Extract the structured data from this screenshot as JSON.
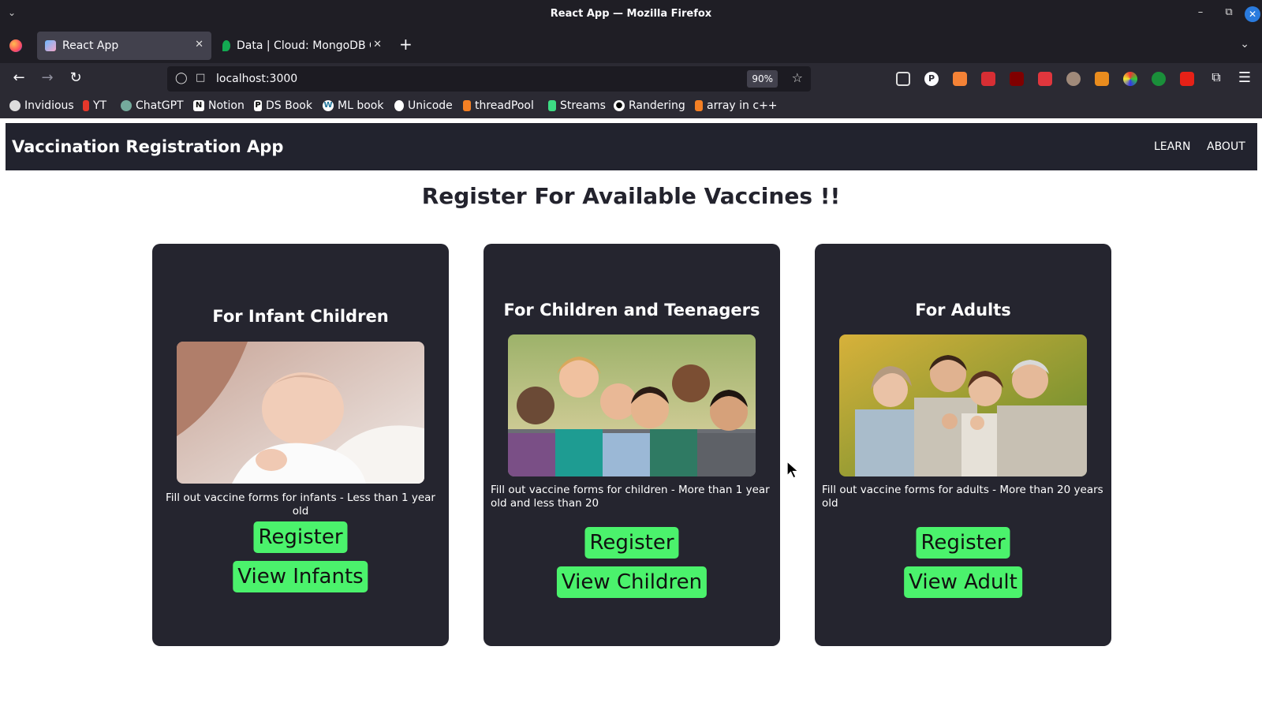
{
  "window": {
    "title": "React App — Mozilla Firefox"
  },
  "tabs": [
    {
      "label": "React App",
      "active": true
    },
    {
      "label": "Data | Cloud: MongoDB C",
      "active": false
    }
  ],
  "address_bar": {
    "url": "localhost:3000",
    "zoom": "90%"
  },
  "bookmarks": [
    {
      "label": "Invidious"
    },
    {
      "label": "YT"
    },
    {
      "label": "ChatGPT"
    },
    {
      "label": "Notion"
    },
    {
      "label": "DS Book"
    },
    {
      "label": "ML book"
    },
    {
      "label": "Unicode"
    },
    {
      "label": "threadPool"
    },
    {
      "label": "Streams"
    },
    {
      "label": "Randering"
    },
    {
      "label": "array in c++"
    }
  ],
  "app": {
    "brand": "Vaccination Registration App",
    "nav": [
      "LEARN",
      "ABOUT"
    ],
    "heading": "Register For Available Vaccines !!"
  },
  "cards": [
    {
      "title": "For Infant Children",
      "description": "Fill out vaccine forms for infants - Less than 1 year old",
      "register_label": "Register",
      "view_label": "View Infants"
    },
    {
      "title": "For Children and Teenagers",
      "description": "Fill out vaccine forms for children - More than 1 year old and less than 20",
      "register_label": "Register",
      "view_label": "View Children"
    },
    {
      "title": "For Adults",
      "description": "Fill out vaccine forms for adults - More than 20 years old",
      "register_label": "Register",
      "view_label": "View Adult"
    }
  ],
  "colors": {
    "navbar_bg": "#22232e",
    "card_bg": "#25252f",
    "button_green": "#4bf26c"
  }
}
